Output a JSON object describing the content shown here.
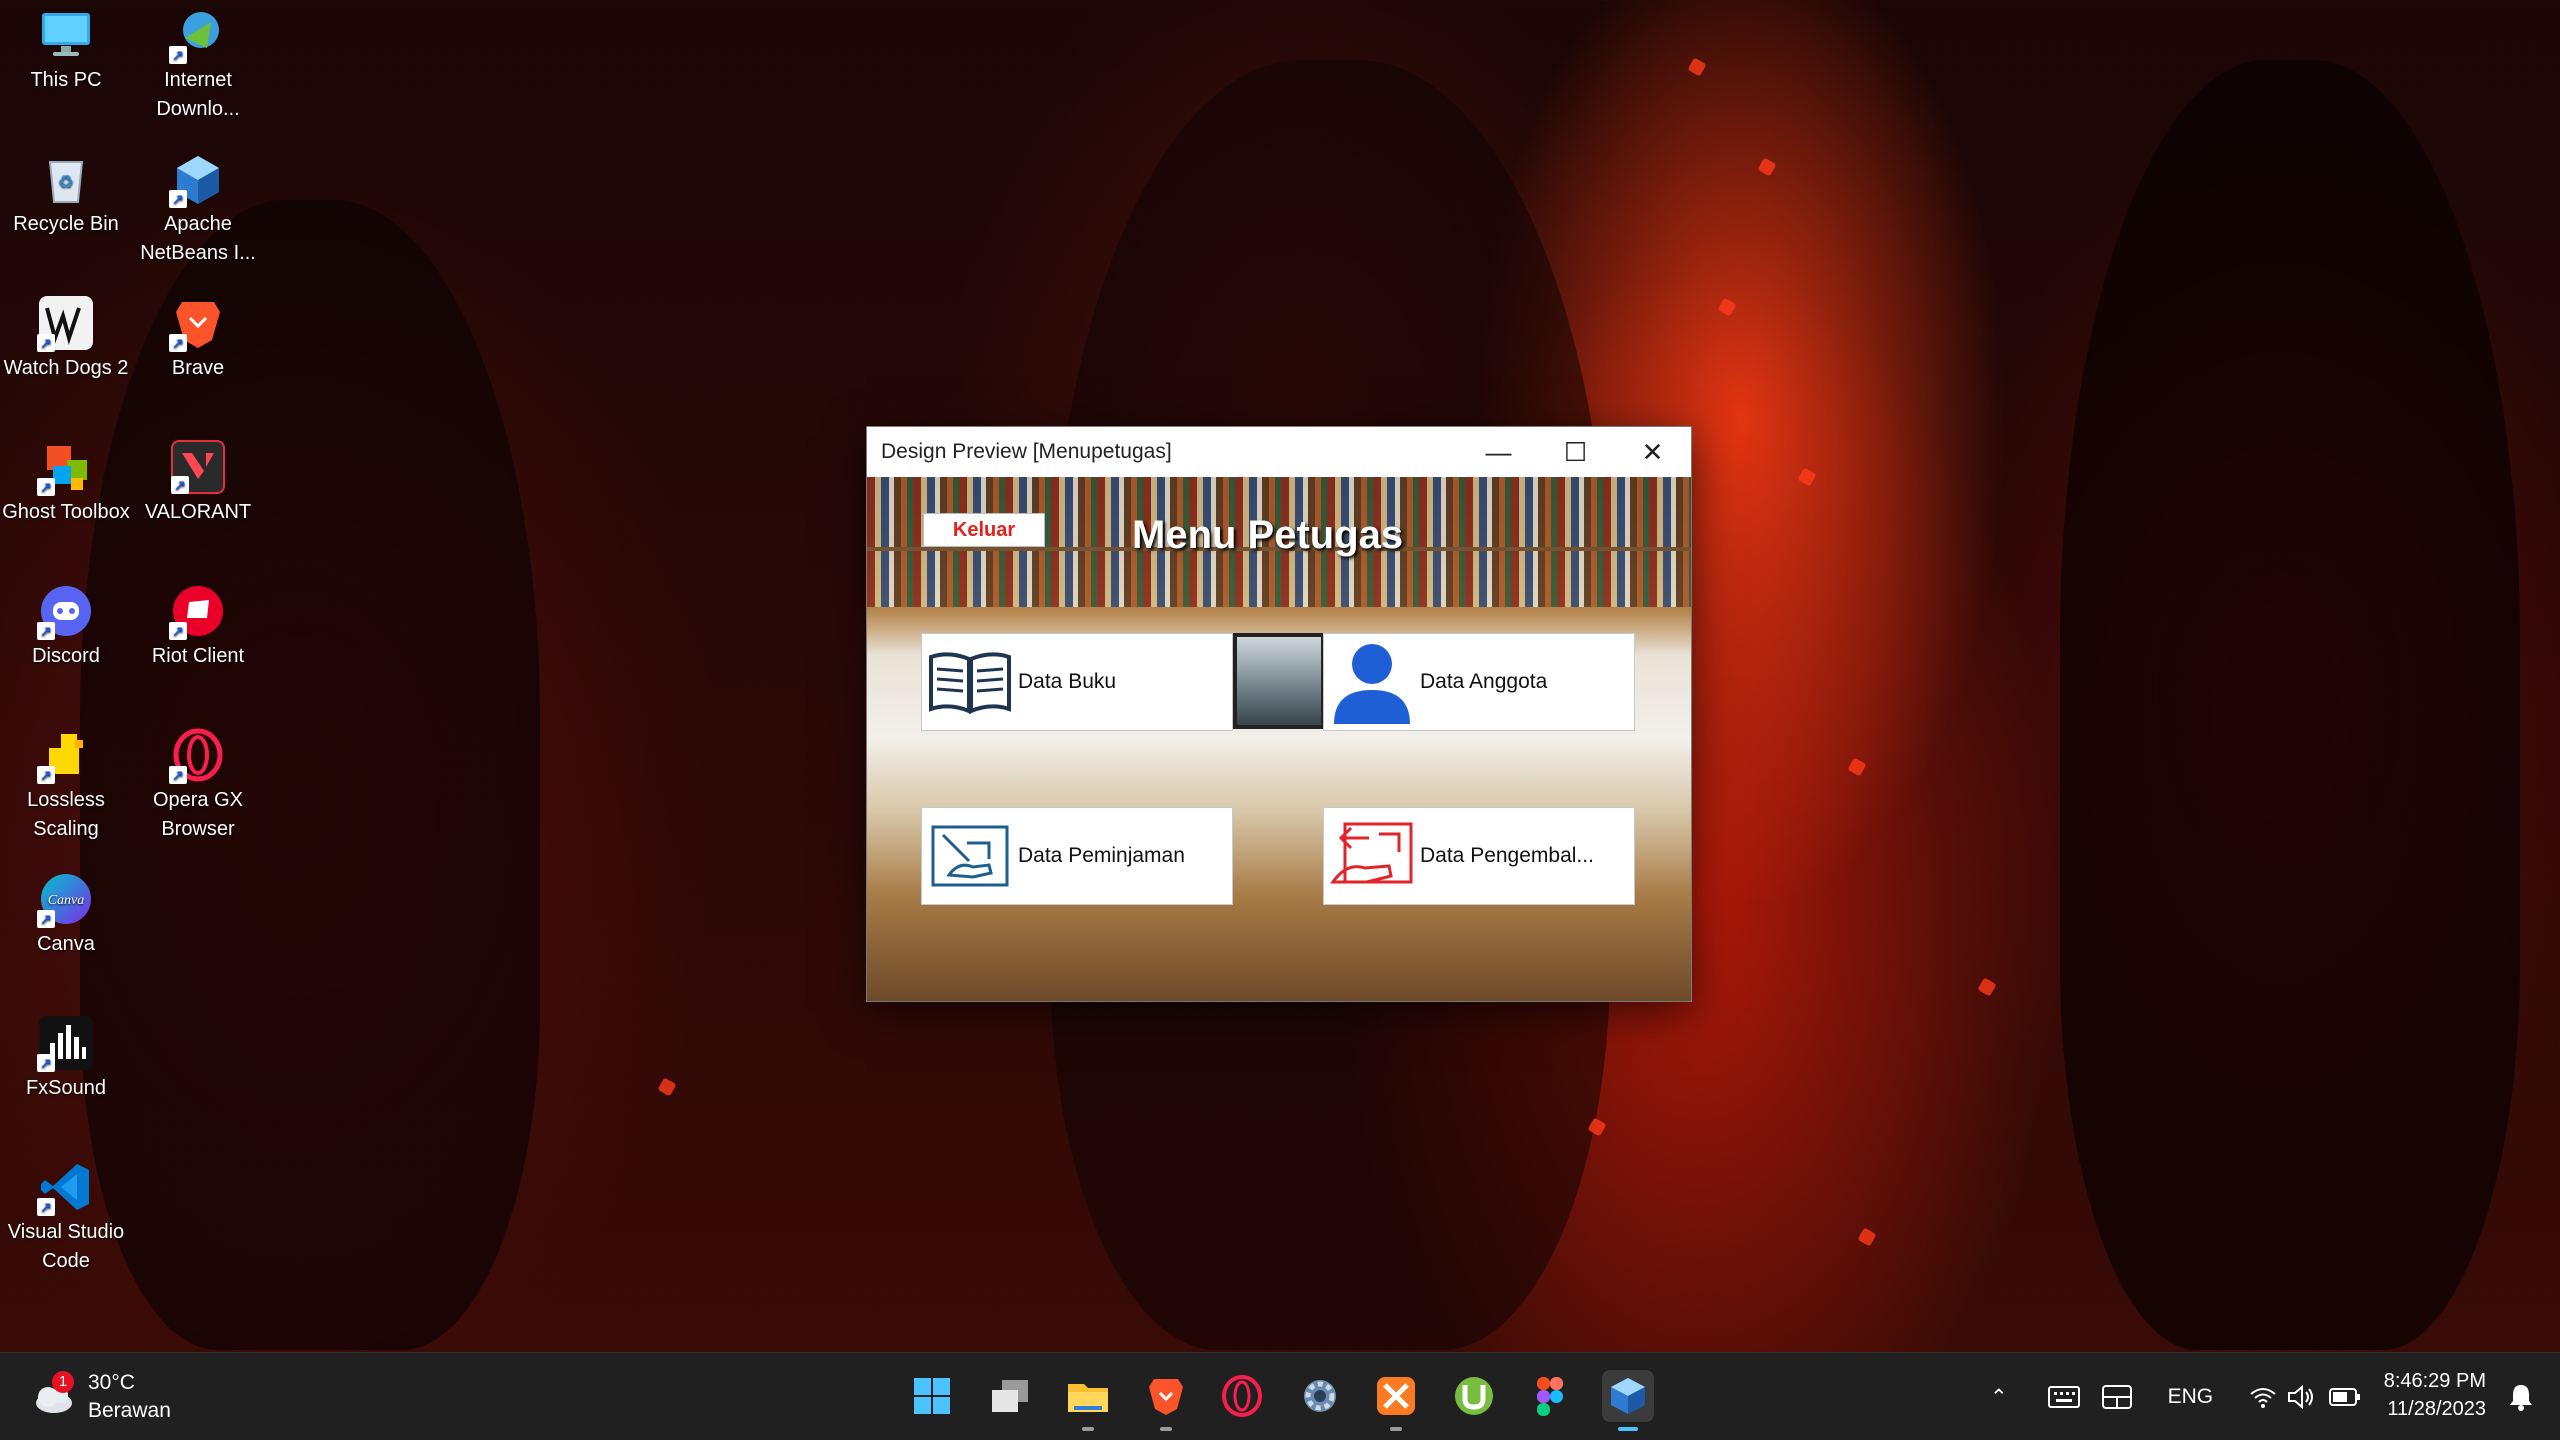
{
  "desktop": {
    "icons": [
      {
        "label": "This PC",
        "icon": "monitor-icon"
      },
      {
        "label": "Internet Downlo...",
        "icon": "internet-download-manager-icon"
      },
      {
        "label": "Recycle Bin",
        "icon": "recycle-bin-icon"
      },
      {
        "label": "Apache NetBeans I...",
        "icon": "netbeans-icon"
      },
      {
        "label": "Watch Dogs 2",
        "icon": "watch-dogs-icon"
      },
      {
        "label": "Brave",
        "icon": "brave-icon"
      },
      {
        "label": "Ghost Toolbox",
        "icon": "ghost-toolbox-icon"
      },
      {
        "label": "VALORANT",
        "icon": "valorant-icon"
      },
      {
        "label": "Discord",
        "icon": "discord-icon"
      },
      {
        "label": "Riot Client",
        "icon": "riot-client-icon"
      },
      {
        "label": "Lossless Scaling",
        "icon": "lossless-scaling-icon"
      },
      {
        "label": "Opera GX Browser",
        "icon": "opera-gx-icon"
      },
      {
        "label": "Canva",
        "icon": "canva-icon"
      },
      {
        "label": "FxSound",
        "icon": "fxsound-icon"
      },
      {
        "label": "Visual Studio Code",
        "icon": "vscode-icon"
      }
    ]
  },
  "window": {
    "title": "Design Preview [Menupetugas]",
    "minimize": "—",
    "maximize": "☐",
    "close": "✕",
    "keluar_label": "Keluar",
    "heading": "Menu Petugas",
    "tiles": {
      "buku": "Data Buku",
      "anggota": "Data Anggota",
      "peminjaman": "Data Peminjaman",
      "pengembalian": "Data Pengembal..."
    }
  },
  "taskbar": {
    "weather_temp": "30°C",
    "weather_desc": "Berawan",
    "weather_badge": "1",
    "language": "ENG",
    "time": "8:46:29 PM",
    "date": "11/28/2023",
    "apps": [
      "start-icon",
      "task-view-icon",
      "file-explorer-icon",
      "brave-icon",
      "opera-icon",
      "settings-icon",
      "xampp-icon",
      "utorrent-icon",
      "figma-icon",
      "netbeans-icon"
    ]
  },
  "colors": {
    "accent_red": "#e2231a",
    "tile_blue": "#1f5fd6",
    "taskbar": "#202020"
  }
}
